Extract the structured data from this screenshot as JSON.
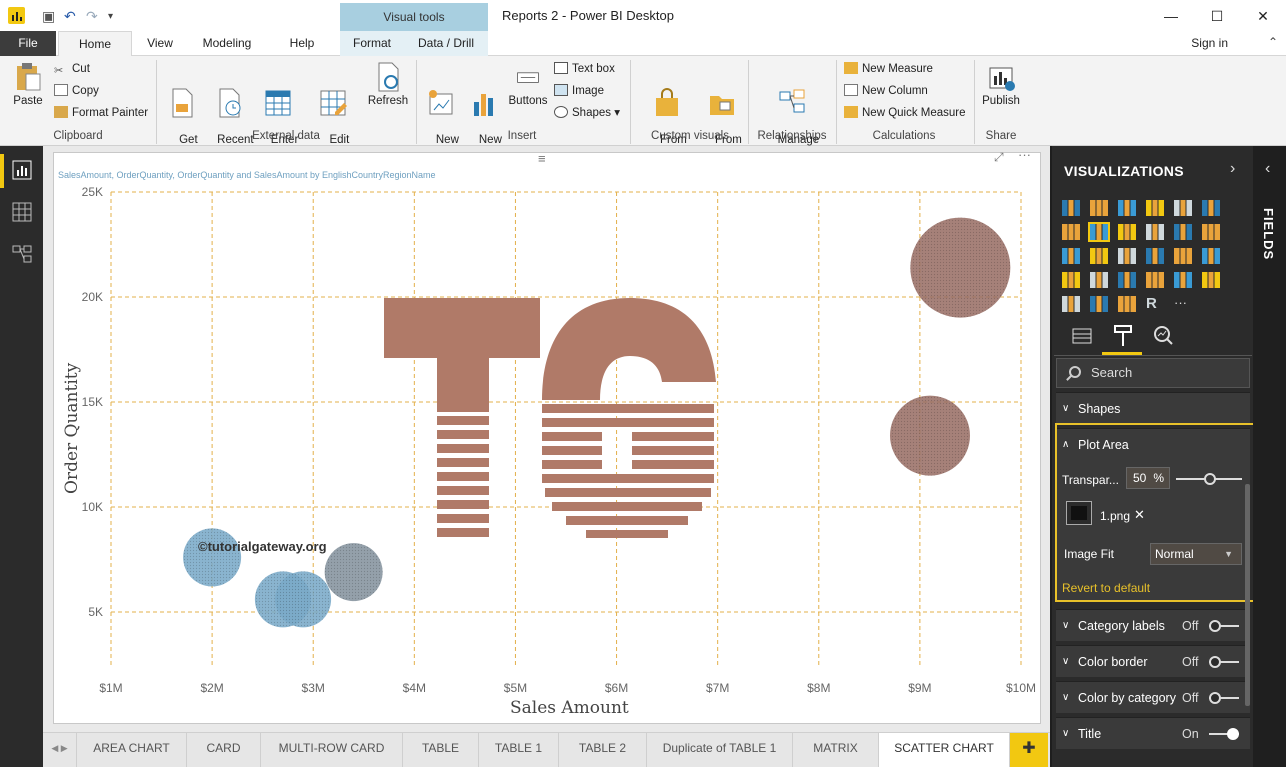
{
  "window": {
    "title": "Reports 2 - Power BI Desktop",
    "context_tab": "Visual tools",
    "minimize": "—",
    "maximize": "☐",
    "close": "✕"
  },
  "tabs": [
    "File",
    "Home",
    "View",
    "Modeling",
    "Help",
    "Format",
    "Data / Drill"
  ],
  "signin": "Sign in",
  "ribbon": {
    "paste": "Paste",
    "cut": "Cut",
    "copy": "Copy",
    "format_painter": "Format Painter",
    "get_data": "Get\nData",
    "recent_sources": "Recent\nSources",
    "enter_data": "Enter\nData",
    "edit_queries": "Edit\nQueries",
    "refresh": "Refresh",
    "new_page": "New\nPage",
    "new_visual": "New\nVisual",
    "buttons": "Buttons",
    "text_box": "Text box",
    "image": "Image",
    "shapes": "Shapes",
    "from_marketplace": "From\nMarketplace",
    "from_file": "From\nFile",
    "manage_relationships": "Manage\nRelationships",
    "new_measure": "New Measure",
    "new_column": "New Column",
    "new_quick_measure": "New Quick Measure",
    "publish": "Publish",
    "groups": [
      "Clipboard",
      "External data",
      "Insert",
      "Custom visuals",
      "Relationships",
      "Calculations",
      "Share"
    ]
  },
  "visual": {
    "title": "SalesAmount, OrderQuantity, OrderQuantity and SalesAmount by EnglishCountryRegionName",
    "watermark": "©tutorialgateway.org",
    "logo_letters": "TG"
  },
  "chart_data": {
    "type": "scatter",
    "xlabel": "Sales Amount",
    "ylabel": "Order Quantity",
    "x_ticks": [
      "$1M",
      "$2M",
      "$3M",
      "$4M",
      "$5M",
      "$6M",
      "$7M",
      "$8M",
      "$9M",
      "$10M"
    ],
    "y_ticks": [
      "5K",
      "10K",
      "15K",
      "20K",
      "25K"
    ],
    "xlim": [
      1000000,
      10000000
    ],
    "ylim": [
      2000,
      25000
    ],
    "grid": true,
    "points": [
      {
        "x": 2000000,
        "y": 7600,
        "size": 29,
        "color": "#7aaac8"
      },
      {
        "x": 2700000,
        "y": 5600,
        "size": 28,
        "color": "#7aaac8"
      },
      {
        "x": 2900000,
        "y": 5600,
        "size": 28,
        "color": "#7aaac8"
      },
      {
        "x": 3400000,
        "y": 6900,
        "size": 29,
        "color": "#85939e"
      },
      {
        "x": 9400000,
        "y": 21400,
        "size": 50,
        "color": "#9a7066"
      },
      {
        "x": 9100000,
        "y": 13400,
        "size": 40,
        "color": "#9a7066"
      }
    ]
  },
  "pages": [
    "AREA CHART",
    "CARD",
    "MULTI-ROW CARD",
    "TABLE",
    "TABLE 1",
    "TABLE 2",
    "Duplicate of TABLE 1",
    "MATRIX",
    "SCATTER CHART"
  ],
  "pane": {
    "header": "VISUALIZATIONS",
    "fields": "FIELDS",
    "search_placeholder": "Search",
    "sections": {
      "shapes": "Shapes",
      "plot_area": "Plot Area",
      "transparency_label": "Transpar...",
      "transparency_value": "50",
      "percent": "%",
      "image_name": "1.png",
      "image_fit_label": "Image Fit",
      "image_fit_value": "Normal",
      "revert": "Revert to default",
      "category_labels": "Category labels",
      "category_labels_state": "Off",
      "color_border": "Color border",
      "color_border_state": "Off",
      "color_by_category": "Color by category",
      "color_by_category_state": "Off",
      "title": "Title",
      "title_state": "On"
    }
  },
  "colors": {
    "accent": "#f2c811",
    "grid": "#e3b04b",
    "logo": "#b07a68"
  }
}
